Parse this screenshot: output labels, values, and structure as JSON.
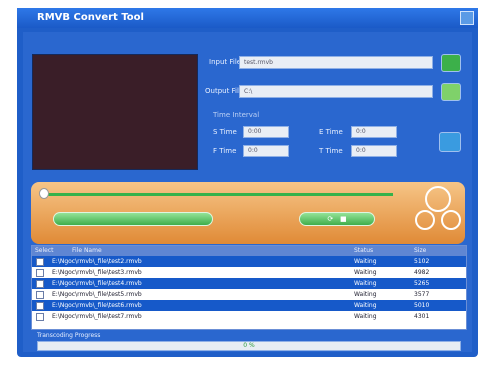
{
  "window": {
    "title": "RMVB Convert Tool"
  },
  "io": {
    "input_label": "Input File",
    "output_label": "Output File",
    "input_value": "test.rmvb",
    "output_value": "C:\\"
  },
  "trim": {
    "group_label": "Time Interval",
    "s_time_label": "S Time",
    "e_time_label": "E Time",
    "f_time_label": "F Time",
    "t_time_label": "T Time",
    "s_time_value": "0:00",
    "e_time_value": "0:0",
    "f_time_value": "0:0",
    "t_time_value": "0:0"
  },
  "list": {
    "columns": [
      "Select",
      "File Name",
      "",
      "Status",
      "Size"
    ],
    "rows": [
      {
        "name": "E:\\Ngoc\\rmvb\\_file\\test2.rmvb",
        "status": "Waiting",
        "size": "5102",
        "selected": true
      },
      {
        "name": "E:\\Ngoc\\rmvb\\_file\\test3.rmvb",
        "status": "Waiting",
        "size": "4982",
        "selected": false
      },
      {
        "name": "E:\\Ngoc\\rmvb\\_file\\test4.rmvb",
        "status": "Waiting",
        "size": "5265",
        "selected": true
      },
      {
        "name": "E:\\Ngoc\\rmvb\\_file\\test5.rmvb",
        "status": "Waiting",
        "size": "3577",
        "selected": false
      },
      {
        "name": "E:\\Ngoc\\rmvb\\_file\\test6.rmvb",
        "status": "Waiting",
        "size": "5010",
        "selected": true
      },
      {
        "name": "E:\\Ngoc\\rmvb\\_file\\test7.rmvb",
        "status": "Waiting",
        "size": "4301",
        "selected": false
      }
    ]
  },
  "progress": {
    "label": "Transcoding Progress",
    "value_text": "0 %",
    "percent": 0
  },
  "colors": {
    "window_blue": "#1f5ec8",
    "panel_orange": "#e08a36",
    "accent_green": "#35b24a",
    "row_selected": "#1659c9"
  }
}
